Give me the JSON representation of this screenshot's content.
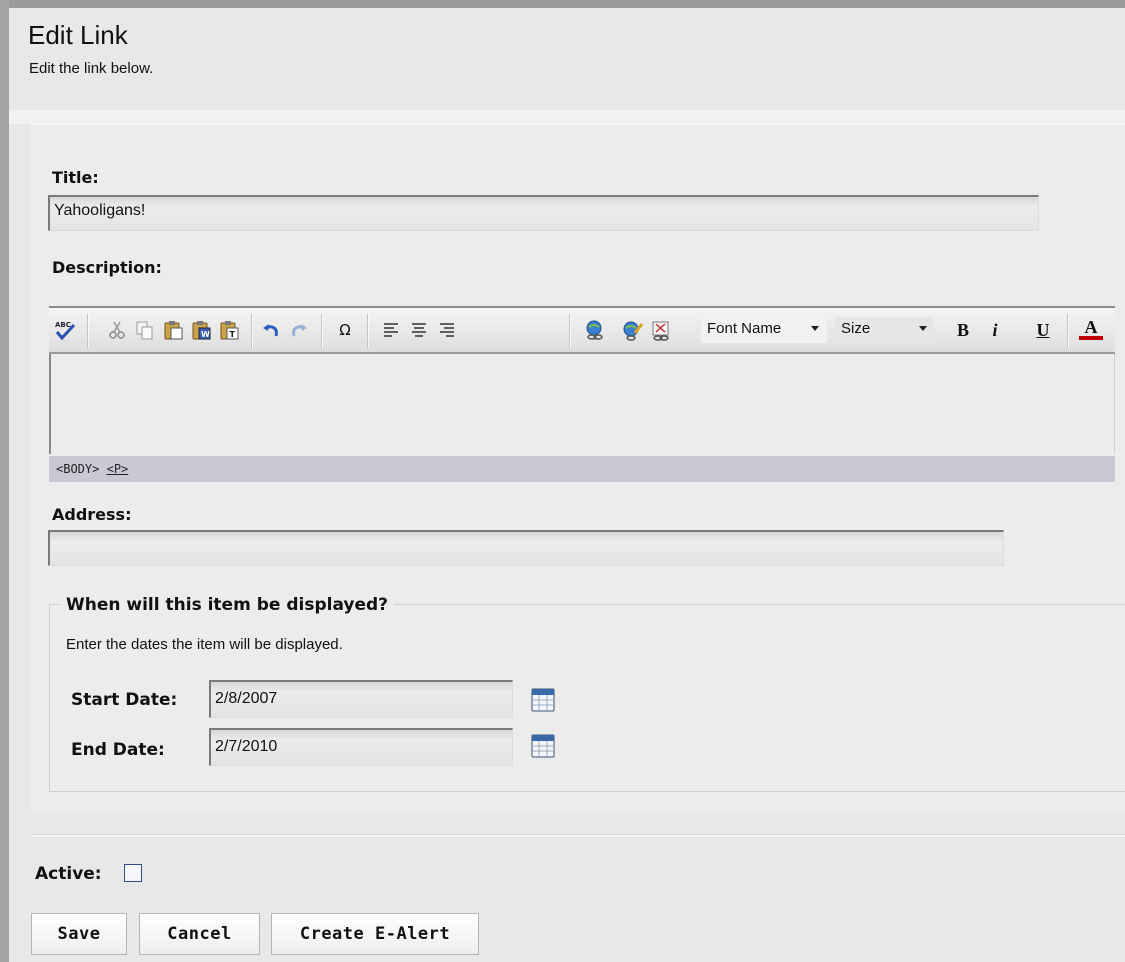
{
  "header": {
    "title": "Edit Link",
    "subtitle": "Edit the link below."
  },
  "form": {
    "title_label": "Title:",
    "title_value": "Yahooligans!",
    "description_label": "Description:",
    "address_label": "Address:",
    "address_value": ""
  },
  "editor": {
    "toolbar": {
      "font_name": "Font Name",
      "size": "Size",
      "bold_glyph": "B",
      "italic_glyph": "i",
      "underline_glyph": "U",
      "fontcolor_glyph": "A",
      "special_char_glyph": "Ω"
    },
    "path": {
      "body_tag": "<BODY>",
      "p_tag": "<P>"
    }
  },
  "display": {
    "legend": "When will this item be displayed?",
    "help": "Enter the dates the item will be displayed.",
    "start_label": "Start Date:",
    "start_value": "2/8/2007",
    "end_label": "End Date:",
    "end_value": "2/7/2010"
  },
  "active": {
    "label": "Active:",
    "checked": false
  },
  "buttons": {
    "save": "Save",
    "cancel": "Cancel",
    "create_alert": "Create E-Alert"
  },
  "colors": {
    "background": "#e8e8e8",
    "path_bar": "#c9c9d6",
    "checkbox_border": "#2f4f8f"
  }
}
